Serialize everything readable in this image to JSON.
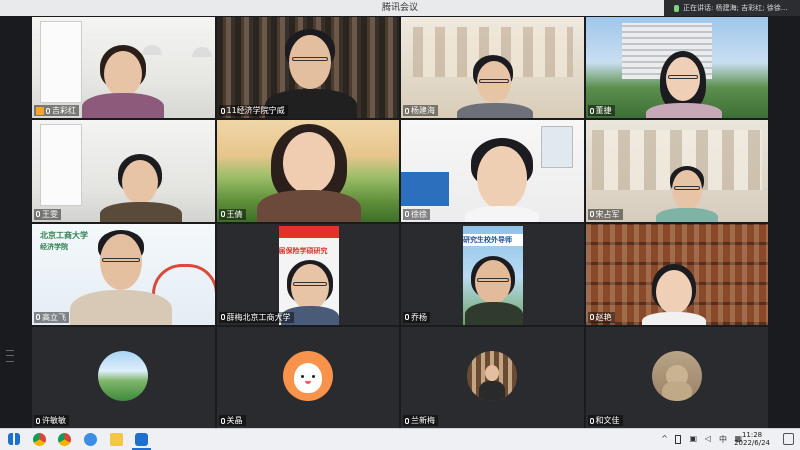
{
  "window": {
    "title": "腾讯会议"
  },
  "speaking_banner": "正在讲话: 杨建海; 吉彩红; 徐徐...",
  "participants": [
    {
      "name": "吉彩红",
      "host": true
    },
    {
      "name": "11经济学院宁威"
    },
    {
      "name": "杨建海"
    },
    {
      "name": "董捷"
    },
    {
      "name": "王雯"
    },
    {
      "name": "王倩"
    },
    {
      "name": "徐徐"
    },
    {
      "name": "宋占军"
    },
    {
      "name": "高立飞"
    },
    {
      "name": "薛梅北京工商大学"
    },
    {
      "name": "乔杨"
    },
    {
      "name": "赵艳"
    },
    {
      "name": "许敏敏"
    },
    {
      "name": "关晶"
    },
    {
      "name": "兰新梅"
    },
    {
      "name": "和文佳"
    }
  ],
  "backgrounds": {
    "university_name": "北京工商大学",
    "school_name": "经济学院",
    "banner_partial": "届保险学硕研究",
    "banner_partial_2": "研究生校外导师"
  },
  "taskbar": {
    "time": "11:28",
    "date": "2022/6/24",
    "ime": "中",
    "icons": [
      "windows-start",
      "chrome",
      "chrome-2",
      "ie",
      "folder",
      "tencent-meeting"
    ]
  },
  "colors": {
    "accent": "#1f6fd1",
    "host_badge": "#f5a623"
  }
}
